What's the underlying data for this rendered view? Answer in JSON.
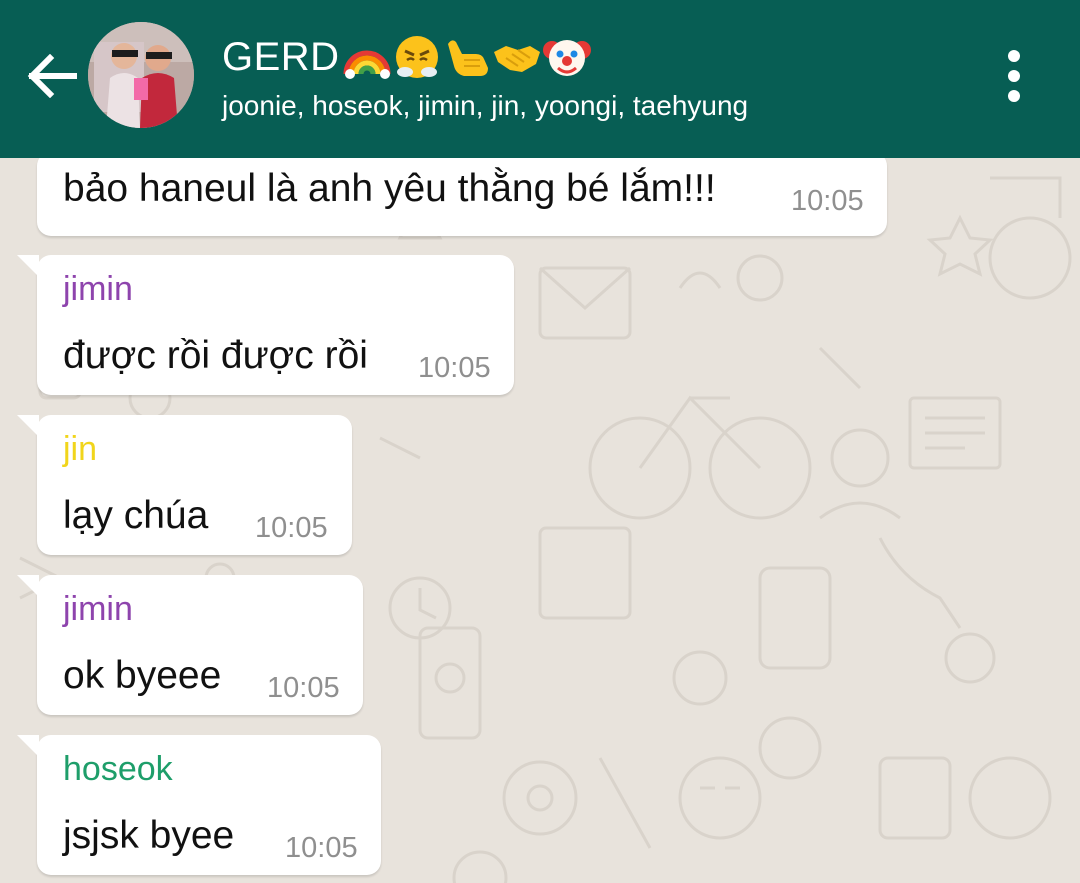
{
  "header": {
    "title": "GERD",
    "title_emojis": [
      "rainbow-icon",
      "steam-face-icon",
      "call-me-hand-icon",
      "handshake-icon",
      "clown-face-icon"
    ],
    "participants": "joonie, hoseok, jimin, jin, yoongi, taehyung",
    "colors": {
      "header_bg": "#075e54",
      "header_text": "#ffffff"
    }
  },
  "messages": [
    {
      "sender": "",
      "text": "bảo haneul là anh yêu thằng bé lắm!!!",
      "time": "10:05"
    },
    {
      "sender": "jimin",
      "sender_color": "#8e44ad",
      "text": "được rồi được rồi",
      "time": "10:05"
    },
    {
      "sender": "jin",
      "sender_color": "#f1d51b",
      "text": "lạy chúa",
      "time": "10:05"
    },
    {
      "sender": "jimin",
      "sender_color": "#8e44ad",
      "text": "ok byeee",
      "time": "10:05"
    },
    {
      "sender": "hoseok",
      "sender_color": "#1e9e6a",
      "text": "jsjsk byee",
      "time": "10:05"
    }
  ],
  "colors": {
    "chat_bg": "#e8e3dc",
    "bubble_bg": "#ffffff",
    "time_text": "#8f8f8f"
  }
}
